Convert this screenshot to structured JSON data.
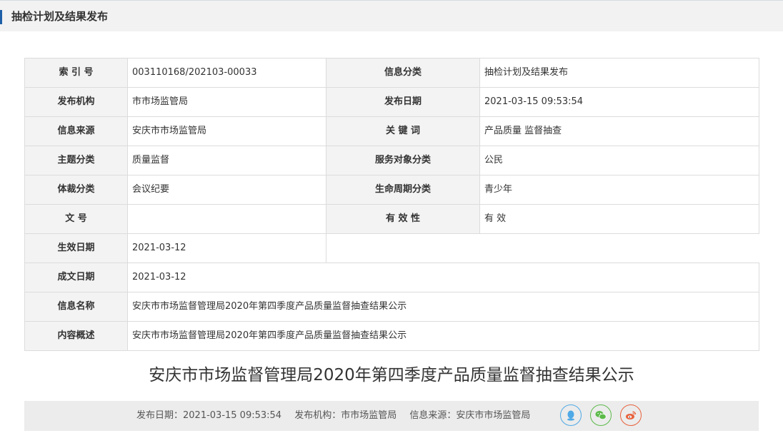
{
  "section": {
    "title": "抽检计划及结果发布"
  },
  "info_table": {
    "index_label": "索 引 号",
    "index_value": "003110168/202103-00033",
    "category_label": "信息分类",
    "category_value": "抽检计划及结果发布",
    "publisher_label": "发布机构",
    "publisher_value": "市市场监管局",
    "pubdate_label": "发布日期",
    "pubdate_value": "2021-03-15 09:53:54",
    "source_label": "信息来源",
    "source_value": "安庆市市场监管局",
    "keywords_label": "关 键 词",
    "keywords_value": "产品质量 监督抽查",
    "topic_label": "主题分类",
    "topic_value": "质量监督",
    "audience_label": "服务对象分类",
    "audience_value": "公民",
    "genre_label": "体裁分类",
    "genre_value": "会议纪要",
    "lifecycle_label": "生命周期分类",
    "lifecycle_value": "青少年",
    "docno_label": "文 号",
    "docno_value": "",
    "validity_label": "有 效 性",
    "validity_value": "有 效",
    "effective_label": "生效日期",
    "effective_value": "2021-03-12",
    "written_label": "成文日期",
    "written_value": "2021-03-12",
    "name_label": "信息名称",
    "name_value": "安庆市市场监督管理局2020年第四季度产品质量监督抽查结果公示",
    "summary_label": "内容概述",
    "summary_value": "安庆市市场监督管理局2020年第四季度产品质量监督抽查结果公示"
  },
  "document": {
    "title": "安庆市市场监督管理局2020年第四季度产品质量监督抽查结果公示"
  },
  "footer": {
    "pubdate": "发布日期：2021-03-15 09:53:54",
    "publisher": "发布机构：市市场监管局",
    "source": "信息来源：安庆市市场监管局",
    "share_icons": [
      "qq-icon",
      "wechat-icon",
      "weibo-icon"
    ],
    "colors": {
      "qq": "#4fa9e6",
      "wechat": "#5cba4a",
      "weibo": "#e8613c"
    }
  }
}
